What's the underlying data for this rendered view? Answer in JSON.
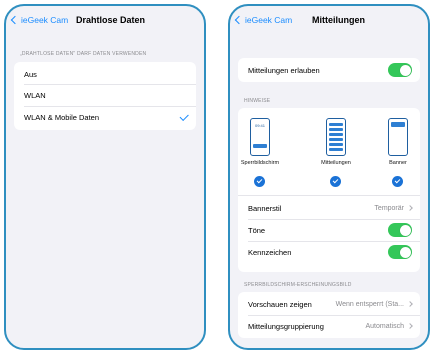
{
  "screen1": {
    "back_label": "ieGeek Cam",
    "title": "Drahtlose Daten",
    "section_header": "„DRAHTLOSE DATEN\" DARF DATEN VERWENDEN",
    "options": [
      "Aus",
      "WLAN",
      "WLAN & Mobile Daten"
    ],
    "selected": "WLAN & Mobile Daten"
  },
  "screen2": {
    "back_label": "ieGeek Cam",
    "title": "Mitteilungen",
    "allow_label": "Mitteilungen erlauben",
    "hints_header": "HINWEISE",
    "lock_time": "09:41",
    "styles": [
      "Sperrbildschirm",
      "Mitteilungen",
      "Banner"
    ],
    "banner_style_label": "Bannerstil",
    "banner_style_value": "Temporär",
    "sounds_label": "Töne",
    "badges_label": "Kennzeichen",
    "lock_header": "SPERRBILDSCHIRM-ERSCHEINUNGSBILD",
    "preview_label": "Vorschauen zeigen",
    "preview_value": "Wenn entsperrt (Sta...",
    "grouping_label": "Mitteilungsgruppierung",
    "grouping_value": "Automatisch"
  },
  "colors": {
    "accent": "#1a8cff",
    "toggle_on": "#34c759",
    "frame": "#2f8fc0"
  }
}
